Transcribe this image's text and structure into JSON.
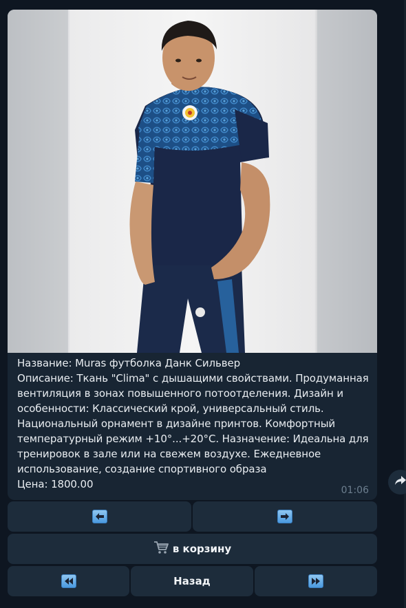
{
  "message": {
    "caption_lines": [
      "Название: Muras футболка Данк Сильвер",
      "Описание: Ткань \"Clima\" с дышащими свойствами. Продуманная вентиляция в зонах повышенного потоотделения. Дизайн и особенности: Классический крой, универсальный стиль. Национальный орнамент в дизайне принтов. Комфортный температурный режим +10°...+20°C. Назначение: Идеальна для тренировок в зале или на свежем воздухе. Ежедневное использование, создание спортивного образа",
      "Цена: 1800.00"
    ],
    "time": "01:06"
  },
  "keyboard": {
    "prev_icon": "left-arrow-icon",
    "next_icon": "right-arrow-icon",
    "cart_icon": "shopping-cart-icon",
    "cart_label": "в корзину",
    "first_icon": "rewind-icon",
    "back_label": "Назад",
    "last_icon": "fast-forward-icon"
  },
  "side": {
    "share_icon": "share-arrow-icon"
  },
  "colors": {
    "chat_bg": "#0e1621",
    "bubble": "#182533",
    "button": "#1d2c3b",
    "text": "#e9edf1",
    "time": "#6d7f8f",
    "emoji_key": "#4a9ae0"
  }
}
